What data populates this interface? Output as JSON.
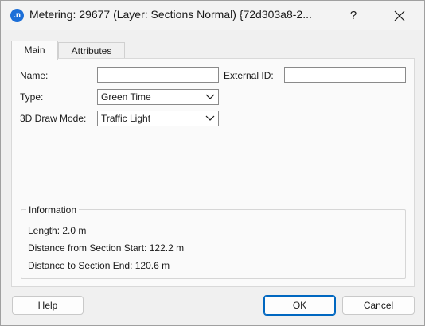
{
  "window": {
    "title": "Metering: 29677 (Layer: Sections Normal) {72d303a8-2...",
    "icon_letter": ".n",
    "help_glyph": "?"
  },
  "tabs": [
    {
      "label": "Main",
      "selected": true
    },
    {
      "label": "Attributes",
      "selected": false
    }
  ],
  "form": {
    "name_label": "Name:",
    "name_value": "",
    "external_id_label": "External ID:",
    "external_id_value": "",
    "type_label": "Type:",
    "type_value": "Green Time",
    "draw_mode_label": "3D Draw Mode:",
    "draw_mode_value": "Traffic Light"
  },
  "information": {
    "title": "Information",
    "length": "Length: 2.0 m",
    "distance_from_start": "Distance from Section Start: 122.2 m",
    "distance_to_end": "Distance to Section End: 120.6 m"
  },
  "buttons": {
    "help": "Help",
    "ok": "OK",
    "cancel": "Cancel"
  },
  "colors": {
    "accent": "#0067c0",
    "app_icon": "#1d6fd8"
  }
}
